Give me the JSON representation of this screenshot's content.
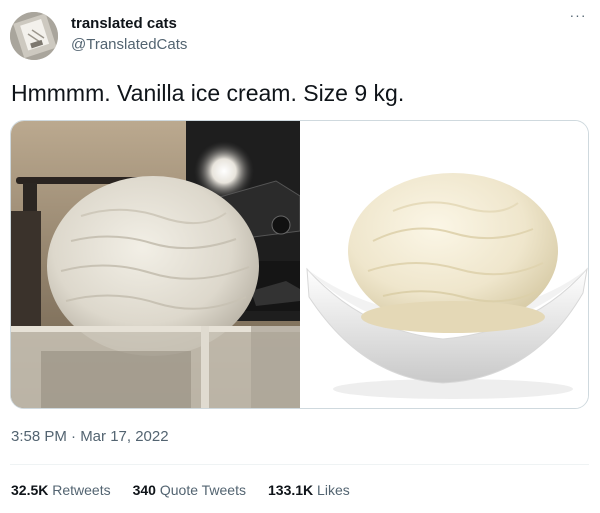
{
  "user": {
    "display_name": "translated cats",
    "handle": "@TranslatedCats",
    "avatar_icon": "avatar-image"
  },
  "menu": {
    "more_glyph": "···"
  },
  "tweet": {
    "text": "Hmmmm. Vanilla ice cream. Size 9 kg.",
    "timestamp": "3:58 PM · Mar 17, 2022"
  },
  "media": [
    {
      "name": "cat-photo"
    },
    {
      "name": "ice-cream-photo"
    }
  ],
  "stats": {
    "retweets": {
      "count": "32.5K",
      "label": "Retweets"
    },
    "quotes": {
      "count": "340",
      "label": "Quote Tweets"
    },
    "likes": {
      "count": "133.1K",
      "label": "Likes"
    }
  },
  "colors": {
    "text_primary": "#0f1419",
    "text_secondary": "#536471",
    "border": "#cfd9de"
  }
}
